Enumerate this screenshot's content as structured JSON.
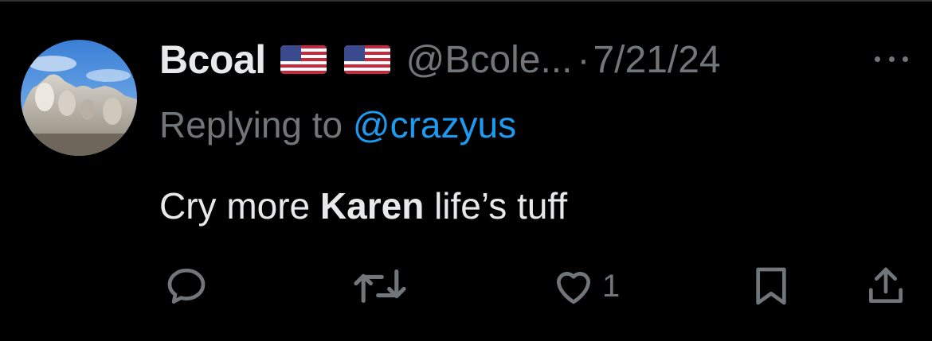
{
  "tweet": {
    "display_name": "Bcoal",
    "badges": [
      "us-flag-icon",
      "us-flag-icon"
    ],
    "handle": "@Bcole...",
    "separator": "·",
    "timestamp": "7/21/24",
    "reply_prefix": "Replying to",
    "reply_to": "@crazyus",
    "text_before": "Cry more",
    "text_bold": "Karen",
    "text_after": "life’s tuff"
  },
  "actions": {
    "reply_icon": "speech-bubble-icon",
    "retweet_icon": "retweet-icon",
    "like_icon": "heart-icon",
    "like_count": "1",
    "bookmark_icon": "bookmark-icon",
    "share_icon": "share-icon"
  },
  "colors": {
    "background": "#000000",
    "text_primary": "#e7e9ea",
    "text_secondary": "#71767b",
    "link": "#1d9bf0",
    "divider": "#2f3336"
  }
}
